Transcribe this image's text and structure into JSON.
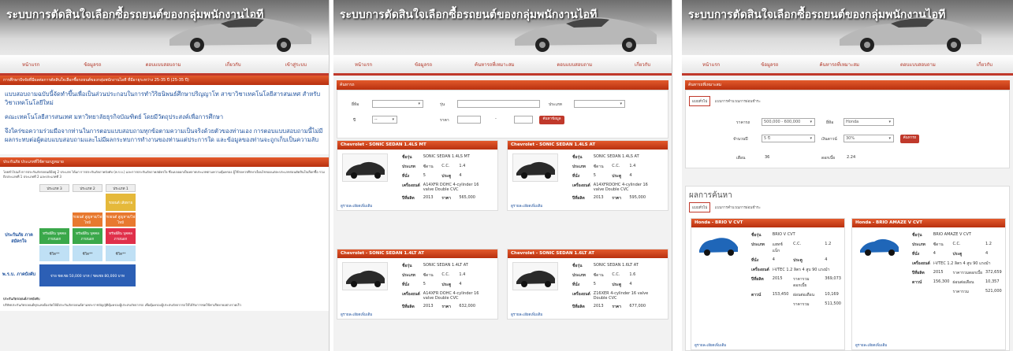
{
  "site_title": "ระบบการตัดสินใจเลือกซื้อรถยนต์ของกลุ่มพนักงานไอที",
  "colors": {
    "accent": "#c0392b",
    "link": "#1b4f9c",
    "car": "#b8b8b8",
    "hatch": "#444",
    "sedan": "#2a2a2a"
  },
  "panel1": {
    "nav": [
      "หน้าแรก",
      "ข้อมูลรถ",
      "ตอบแบบสอบถาม",
      "เกี่ยวกับ",
      "เข้าสู่ระบบ"
    ],
    "bar": "การศึกษาปัจจัยที่มีผลต่อการตัดสินใจเลือกซื้อรถยนต์ของกลุ่มพนักงานไอที ที่มีอายุระหว่าง 25-35 ปี (25-35 ปี)",
    "intro": [
      "แบบสอบถามฉบับนี้จัดทำขึ้นเพื่อเป็นส่วนประกอบในการทำวิริยนิพนธ์ศึกษาปริญญาโท สาขาวิชาเทคโนโลยีสารสนเทศ สำหรับวิชาเทคโนโลยีใหม่",
      "คณะเทคโนโลยีสารสนเทศ มหาวิทยาลัยธุรกิจบัณฑิตย์ โดยมีวัตถุประสงค์เพื่อการศึกษา",
      "จึงใคร่ขอความร่วมมือจากท่านในการตอบแบบสอบถามทุกข้อตามความเป็นจริงด้วยตัวของท่านเอง การตอบแบบสอบถามนี้ไม่มีผลกระทบต่อผู้ตอบแบบสอบถามและไม่มีผลกระทบการทำงานของท่านแต่ประการใด และข้อมูลของท่านจะถูกเก็บเป็นความลับ"
    ],
    "bar2": "ประกันภัย ประเภทที่ใช้ตามกฎหมาย",
    "legal": "โดยทั่วไปแล้วการประกันภัยรถยนต์มีอยู่ 2 ประเภท ได้แก่ การประกันภัยภาคบังคับ (พ.ร.บ.) และการประกันภัยภาคสมัครใจ ซึ่งแบ่งออกเป็นหลายประเภทตามความคุ้มครอง ผู้ใช้รถควรศึกษาเงื่อนไขของแต่ละประเภทก่อนตัดสินใจเลือกซื้อ รวมถึงประเภทที่ 1 ประเภทที่ 2 และประเภทที่ 3",
    "diagram": {
      "cols": [
        "ประเภท 3",
        "ประเภท 2",
        "ประเภท 1"
      ],
      "left_labels": [
        "ประกันภัย ภาคสมัครใจ",
        "พ.ร.บ. ภาคบังคับ"
      ],
      "top": "รถยนต์ เสียหาย",
      "mid": [
        "ทรัพย์สิน บุคคลภายนอก",
        "ทรัพย์สิน บุคคลภายนอก",
        "ทรัพย์สิน บุคคลภายนอก"
      ],
      "orange": [
        "รถยนต์ สูญหาย/ไฟไหม้",
        "รถยนต์ สูญหาย/ไฟไหม้"
      ],
      "small": [
        "ชีวิต**",
        "ชีวิต**",
        "ชีวิต**"
      ],
      "blue": "จ่าย ชดเชย 50,000 บาท / ชดเชย 80,000 บาท"
    },
    "footer_title": "ประกันภัยรถยนต์ภาคบังคับ",
    "footer": "บริษัทประกันภัยรถยนต์ทุกแห่งต้องจัดให้มีประกันภัยรถยนต์ตามพระราชบัญญัติคุ้มครองผู้ประสบภัยจากรถ เพื่อคุ้มครองผู้ประสบภัยจากรถให้ได้รับการชดใช้ค่าเสียหายอย่างรวดเร็ว"
  },
  "panel2": {
    "nav": [
      "หน้าแรก",
      "ข้อมูลรถ",
      "ค้นหารถที่เหมาะสม",
      "ตอบแบบสอบถาม",
      "เกี่ยวกับ"
    ],
    "bar": "ค้นหารถ",
    "filters": {
      "brand": "ยี่ห้อ",
      "model": "รุ่น",
      "type": "ประเภท",
      "year": "ปี",
      "price": "ราคา",
      "year_value": "--",
      "search_btn": "ค้นหาข้อมูล"
    },
    "cards": [
      {
        "head": "Chevrolet - SONIC SEDAN 1.4LS MT",
        "model": "SONIC SEDAN 1.4LS MT",
        "type": "ซีดาน",
        "cc": "1.4",
        "seats": "5",
        "doors": "4",
        "engine": "A14XFR DOHC 4-cylinder 16 valve Double CVC",
        "year": "2013",
        "price": "565,000",
        "more": "ดูรายละเอียดเพิ่มเติม"
      },
      {
        "head": "Chevrolet - SONIC SEDAN 1.4LS AT",
        "model": "SONIC SEDAN 1.4LS AT",
        "type": "ซีดาน",
        "cc": "1.4",
        "seats": "5",
        "doors": "4",
        "engine": "A14XFRDOHC 4-cylinder 16 valve Double CVC",
        "year": "2013",
        "price": "595,000",
        "more": "ดูรายละเอียดเพิ่มเติม"
      },
      {
        "head": "Chevrolet - SONIC SEDAN 1.4LT AT",
        "model": "SONIC SEDAN 1.4LT AT",
        "type": "ซีดาน",
        "cc": "1.4",
        "seats": "5",
        "doors": "4",
        "engine": "A14XFR DOHC 4-cylinder 16 valve Double CVC",
        "year": "2013",
        "price": "632,000",
        "more": "ดูรายละเอียดเพิ่มเติม"
      },
      {
        "head": "Chevrolet - SONIC SEDAN 1.6LT AT",
        "model": "SONIC SEDAN 1.6LT AT",
        "type": "ซีดาน",
        "cc": "1.6",
        "seats": "5",
        "doors": "4",
        "engine": "Z16XER 4-cylinder 16 valve Double CVC",
        "year": "2013",
        "price": "677,000",
        "more": "ดูรายละเอียดเพิ่มเติม"
      }
    ],
    "labels": {
      "model": "ชื่อรุ่น",
      "type": "ประเภท",
      "cc": "C.C.",
      "seats": "ที่นั่ง",
      "doors": "ประตู",
      "engine": "เครื่องยนต์",
      "year": "ปีที่ผลิต",
      "price": "ราคา"
    }
  },
  "panel3": {
    "nav": [
      "หน้าแรก",
      "ข้อมูลรถ",
      "ค้นหารถที่เหมาะสม",
      "ตอบแบบสอบถาม",
      "เกี่ยวกับ"
    ],
    "bar": "ค้นหารถที่เหมาะสม",
    "tabs": [
      "แบบทั่วไป",
      "แบบการคำนวณการผ่อนชำระ"
    ],
    "form": {
      "price_label": "ราคารถ",
      "price_value": "500,000 - 600,000",
      "brand_label": "ยี่ห้อ",
      "brand_value": "Honda",
      "down_label": "จำนวนปี",
      "down_value": "5 ปี",
      "interest_label": "เงินดาวน์",
      "interest_value": "30%",
      "search_btn": "ค้นหารถ",
      "months_label": "เดือน",
      "months_value": "36",
      "rate_label": "ดอกเบี้ย",
      "rate_value": "2.24"
    },
    "results_title": "ผลการค้นหา",
    "cards": [
      {
        "head": "Honda - BRIO V CVT",
        "model": "BRIO V CVT",
        "type": "แฮทช์แบ็ก",
        "cc": "1.2",
        "seats": "4",
        "doors": "4",
        "engine": "i-VTEC 1.2 ลิตร 4 สูบ 90 แรงม้า",
        "year": "2015",
        "price_label": "ราคารวมดอกเบี้ย",
        "price": "369,073",
        "down": "153,450",
        "monthly_label": "ผ่อนต่อเดือน",
        "monthly": "10,169",
        "total_label": "ราคารวม",
        "total": "511,500",
        "more": "ดูรายละเอียดเพิ่มเติม"
      },
      {
        "head": "Honda - BRIO AMAZE V CVT",
        "model": "BRIO AMAZE V CVT",
        "type": "ซีดาน",
        "cc": "1.2",
        "seats": "4",
        "doors": "4",
        "engine": "i-VTEC 1.2 ลิตร 4 สูบ 90 แรงม้า",
        "year": "2015",
        "price_label": "ราคารวมดอกเบี้ย",
        "price": "372,659",
        "down": "156,300",
        "monthly_label": "ผ่อนต่อเดือน",
        "monthly": "10,357",
        "total_label": "ราคารวม",
        "total": "521,000",
        "more": "ดูรายละเอียดเพิ่มเติม"
      }
    ],
    "labels": {
      "model": "ชื่อรุ่น",
      "type": "ประเภท",
      "cc": "C.C.",
      "seats": "ที่นั่ง",
      "doors": "ประตู",
      "engine": "เครื่องยนต์",
      "year": "ปีที่ผลิต",
      "down": "ดาวน์"
    }
  }
}
